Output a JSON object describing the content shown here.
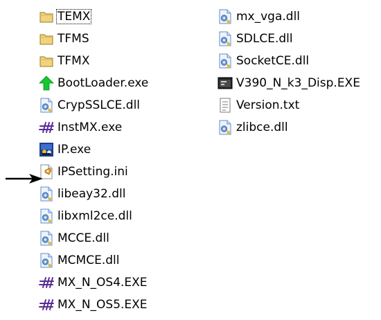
{
  "files": {
    "col1": [
      {
        "name": "TEMX",
        "icon": "folder-icon",
        "focused": true
      },
      {
        "name": "TFMS",
        "icon": "folder-icon"
      },
      {
        "name": "TFMX",
        "icon": "folder-icon"
      },
      {
        "name": "BootLoader.exe",
        "icon": "green-up-arrow-icon"
      },
      {
        "name": "CrypSSLCE.dll",
        "icon": "dll-icon"
      },
      {
        "name": "InstMX.exe",
        "icon": "purple-hash-icon"
      },
      {
        "name": "IP.exe",
        "icon": "app-icon"
      },
      {
        "name": "IPSetting.ini",
        "icon": "ini-settings-icon"
      },
      {
        "name": "libeay32.dll",
        "icon": "dll-icon"
      },
      {
        "name": "libxml2ce.dll",
        "icon": "dll-icon"
      },
      {
        "name": "MCCE.dll",
        "icon": "dll-icon"
      },
      {
        "name": "MCMCE.dll",
        "icon": "dll-icon"
      },
      {
        "name": "MX_N_OS4.EXE",
        "icon": "purple-hash-icon"
      },
      {
        "name": "MX_N_OS5.EXE",
        "icon": "purple-hash-icon"
      }
    ],
    "col2": [
      {
        "name": "mx_vga.dll",
        "icon": "dll-icon"
      },
      {
        "name": "SDLCE.dll",
        "icon": "dll-icon"
      },
      {
        "name": "SocketCE.dll",
        "icon": "dll-icon"
      },
      {
        "name": "V390_N_k3_Disp.EXE",
        "icon": "console-exe-icon"
      },
      {
        "name": "Version.txt",
        "icon": "text-file-icon"
      },
      {
        "name": "zlibce.dll",
        "icon": "dll-icon"
      }
    ]
  },
  "colors": {
    "folder": "#f2d37c",
    "green_arrow": "#14c832",
    "purple": "#5a2a96",
    "dll_blue": "#5d8fc8"
  }
}
